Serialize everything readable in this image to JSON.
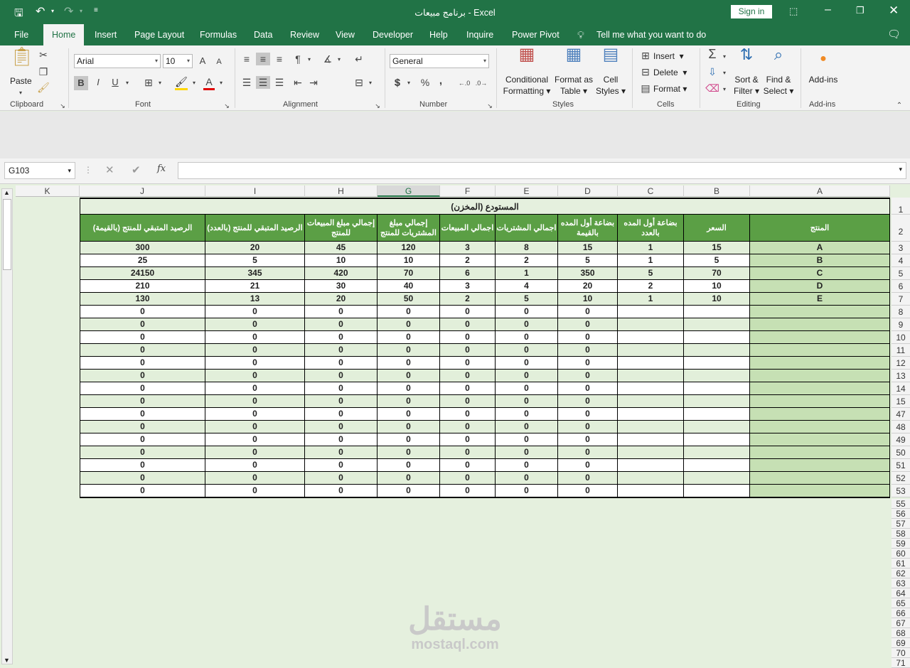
{
  "titlebar": {
    "title": "برنامج مبيعات  -  Excel",
    "sign_in": "Sign in"
  },
  "tabs": [
    "File",
    "Home",
    "Insert",
    "Page Layout",
    "Formulas",
    "Data",
    "Review",
    "View",
    "Developer",
    "Help",
    "Inquire",
    "Power Pivot"
  ],
  "tell_me": "Tell me what you want to do",
  "ribbon": {
    "clipboard": {
      "paste": "Paste",
      "label": "Clipboard"
    },
    "font": {
      "name": "Arial",
      "size": "10",
      "label": "Font",
      "bold": "B",
      "italic": "I",
      "underline": "U",
      "grow": "A",
      "shrink": "A",
      "color_letter": "A"
    },
    "alignment": {
      "label": "Alignment"
    },
    "number": {
      "format": "General",
      "label": "Number",
      "percent": "%",
      "comma": ","
    },
    "styles": {
      "conditional": "Conditional",
      "formatting": "Formatting",
      "format_as": "Format as",
      "table": "Table",
      "cell": "Cell",
      "styles_word": "Styles",
      "label": "Styles"
    },
    "cells": {
      "insert": "Insert",
      "delete": "Delete",
      "format": "Format",
      "label": "Cells"
    },
    "editing": {
      "sort": "Sort &",
      "filter": "Filter",
      "find": "Find &",
      "select": "Select",
      "label": "Editing"
    },
    "addins": {
      "name": "Add-ins",
      "label": "Add-ins"
    }
  },
  "formula_bar": {
    "name_box": "G103",
    "fx": "fx",
    "value": ""
  },
  "sheet": {
    "columns": [
      {
        "letter": "K",
        "width": 90
      },
      {
        "letter": "J",
        "width": 177
      },
      {
        "letter": "I",
        "width": 140
      },
      {
        "letter": "H",
        "width": 102
      },
      {
        "letter": "G",
        "width": 88
      },
      {
        "letter": "F",
        "width": 78
      },
      {
        "letter": "E",
        "width": 88
      },
      {
        "letter": "D",
        "width": 84
      },
      {
        "letter": "C",
        "width": 93
      },
      {
        "letter": "B",
        "width": 93
      },
      {
        "letter": "A",
        "width": 197
      }
    ],
    "selected_column": "G",
    "title": "المستودع (المخزن)",
    "headers": {
      "A": "المنتج",
      "B": "السعر",
      "C": "بضاعة أول المده بالعدد",
      "D": "بضاعة أول المده بالقيمة",
      "E": "اجمالي المشتريات",
      "F": "اجمالي المبيعات",
      "G": "إجمالي مبلغ المشتريات للمنتج",
      "H": "إجمالي مبلغ المبيعات للمنتج",
      "I": "الرصيد المتبقي للمنتج (بالعدد)",
      "J": "الرصيد المتبقي للمنتج  (بالقيمة)"
    },
    "data_rows": [
      {
        "row": "3",
        "A": "A",
        "B": "15",
        "C": "1",
        "D": "15",
        "E": "8",
        "F": "3",
        "G": "120",
        "H": "45",
        "I": "20",
        "J": "300"
      },
      {
        "row": "4",
        "A": "B",
        "B": "5",
        "C": "1",
        "D": "5",
        "E": "2",
        "F": "2",
        "G": "10",
        "H": "10",
        "I": "5",
        "J": "25"
      },
      {
        "row": "5",
        "A": "C",
        "B": "70",
        "C": "5",
        "D": "350",
        "E": "1",
        "F": "6",
        "G": "70",
        "H": "420",
        "I": "345",
        "J": "24150"
      },
      {
        "row": "6",
        "A": "D",
        "B": "10",
        "C": "2",
        "D": "20",
        "E": "4",
        "F": "3",
        "G": "40",
        "H": "30",
        "I": "21",
        "J": "210"
      },
      {
        "row": "7",
        "A": "E",
        "B": "10",
        "C": "1",
        "D": "10",
        "E": "5",
        "F": "2",
        "G": "50",
        "H": "20",
        "I": "13",
        "J": "130"
      }
    ],
    "zero_row_numbers": [
      "8",
      "9",
      "10",
      "11",
      "12",
      "13",
      "14",
      "15",
      "47",
      "48",
      "49",
      "50",
      "51",
      "52",
      "53"
    ],
    "zero_value": "0",
    "empty_row_numbers": [
      "55",
      "56",
      "57",
      "58",
      "59",
      "60",
      "61",
      "62",
      "63",
      "64",
      "65",
      "66",
      "67",
      "68",
      "69",
      "70",
      "71"
    ],
    "header_row_numbers": [
      "1",
      "2"
    ]
  },
  "watermark": {
    "arabic": "مستقل",
    "latin": "mostaql.com"
  }
}
